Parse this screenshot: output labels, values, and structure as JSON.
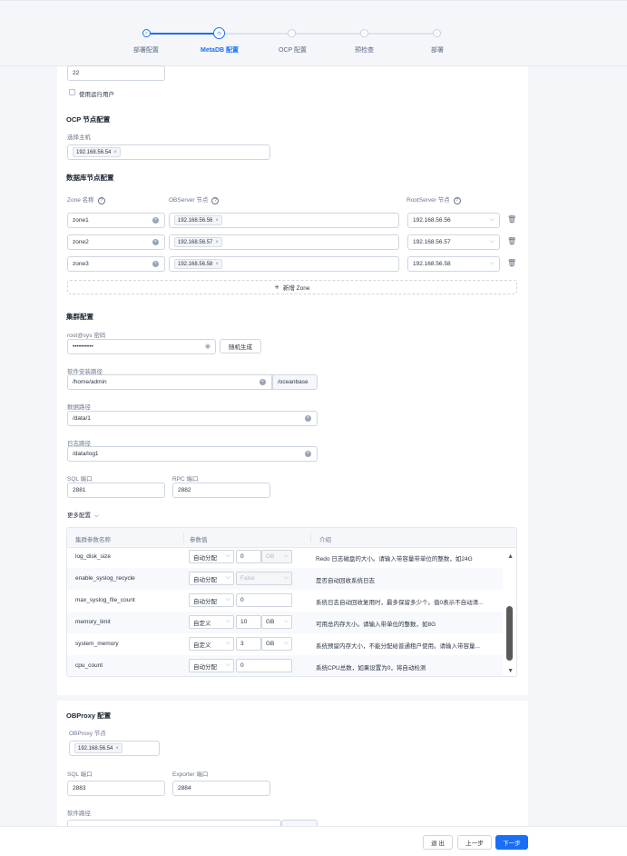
{
  "steps": [
    {
      "label": "部署配置",
      "state": "done"
    },
    {
      "label": "MetaDB 配置",
      "state": "current"
    },
    {
      "label": "OCP 配置",
      "state": "todo"
    },
    {
      "label": "预检查",
      "state": "todo"
    },
    {
      "label": "部署",
      "state": "todo"
    }
  ],
  "top": {
    "port_value": "22",
    "use_run_user_label": "使用运行用户"
  },
  "ocp_node": {
    "title": "OCP 节点配置",
    "host_label": "选择主机",
    "host_tag": "192.168.56.54"
  },
  "db_node": {
    "title": "数据库节点配置",
    "col_zone": "Zone 名称",
    "col_observer": "OBServer 节点",
    "col_rootserver": "RootServer 节点",
    "rows": [
      {
        "zone": "zone1",
        "observer": "192.168.56.56",
        "rootserver": "192.168.56.56"
      },
      {
        "zone": "zone2",
        "observer": "192.168.56.57",
        "rootserver": "192.168.56.57"
      },
      {
        "zone": "zone3",
        "observer": "192.168.56.58",
        "rootserver": "192.168.56.58"
      }
    ],
    "add_zone": "新增 Zone"
  },
  "cluster": {
    "title": "集群配置",
    "pwd_label": "root@sys 密码",
    "pwd_value": "••••••••••",
    "random_btn": "随机生成",
    "install_path_label": "软件安装路径",
    "install_path_value": "/home/admin",
    "install_path_suffix": "/oceanbase",
    "data_path_label": "数据路径",
    "data_path_value": "/data/1",
    "log_path_label": "日志路径",
    "log_path_value": "/data/log1",
    "sql_port_label": "SQL 端口",
    "sql_port_value": "2881",
    "rpc_port_label": "RPC 端口",
    "rpc_port_value": "2882",
    "more_config": "更多配置"
  },
  "params": {
    "col_name": "集群参数名称",
    "col_value": "参数值",
    "col_desc": "介绍",
    "rows": [
      {
        "name": "log_disk_size",
        "mode": "自动分配",
        "value": "0",
        "unit": "GB",
        "desc": "Redo 日志磁盘的大小。请输入带容量带单位的整数，如24G",
        "disabled": true
      },
      {
        "name": "enable_syslog_recycle",
        "mode": "自动分配",
        "value": "False",
        "unit": "",
        "desc": "是否自动回收系统日志",
        "disabled": true
      },
      {
        "name": "max_syslog_file_count",
        "mode": "自动分配",
        "value": "0",
        "unit": "",
        "desc": "系统日志自动回收复用时，最多保留多少个。值0表示不自动清...",
        "disabled": false
      },
      {
        "name": "memory_limit",
        "mode": "自定义",
        "value": "10",
        "unit": "GB",
        "desc": "可用总内存大小。请输入带单位的整数，如8G",
        "disabled": false
      },
      {
        "name": "system_memory",
        "mode": "自定义",
        "value": "3",
        "unit": "GB",
        "desc": "系统预留内存大小，不能分配给普通租户使用。请输入带容量...",
        "disabled": false
      },
      {
        "name": "cpu_count",
        "mode": "自动分配",
        "value": "0",
        "unit": "",
        "desc": "系统CPU总数，如果设置为0，将自动检测",
        "disabled": false
      }
    ]
  },
  "obproxy": {
    "title": "OBProxy 配置",
    "node_label": "OBProxy 节点",
    "node_tag": "192.168.56.54",
    "sql_port_label": "SQL 端口",
    "sql_port_value": "2883",
    "exporter_port_label": "Exporter 端口",
    "exporter_port_value": "2884",
    "software_path_label": "软件路径"
  },
  "footer": {
    "exit": "退 出",
    "prev": "上一步",
    "next": "下一步"
  },
  "colors": {
    "accent": "#1a6ef5"
  }
}
